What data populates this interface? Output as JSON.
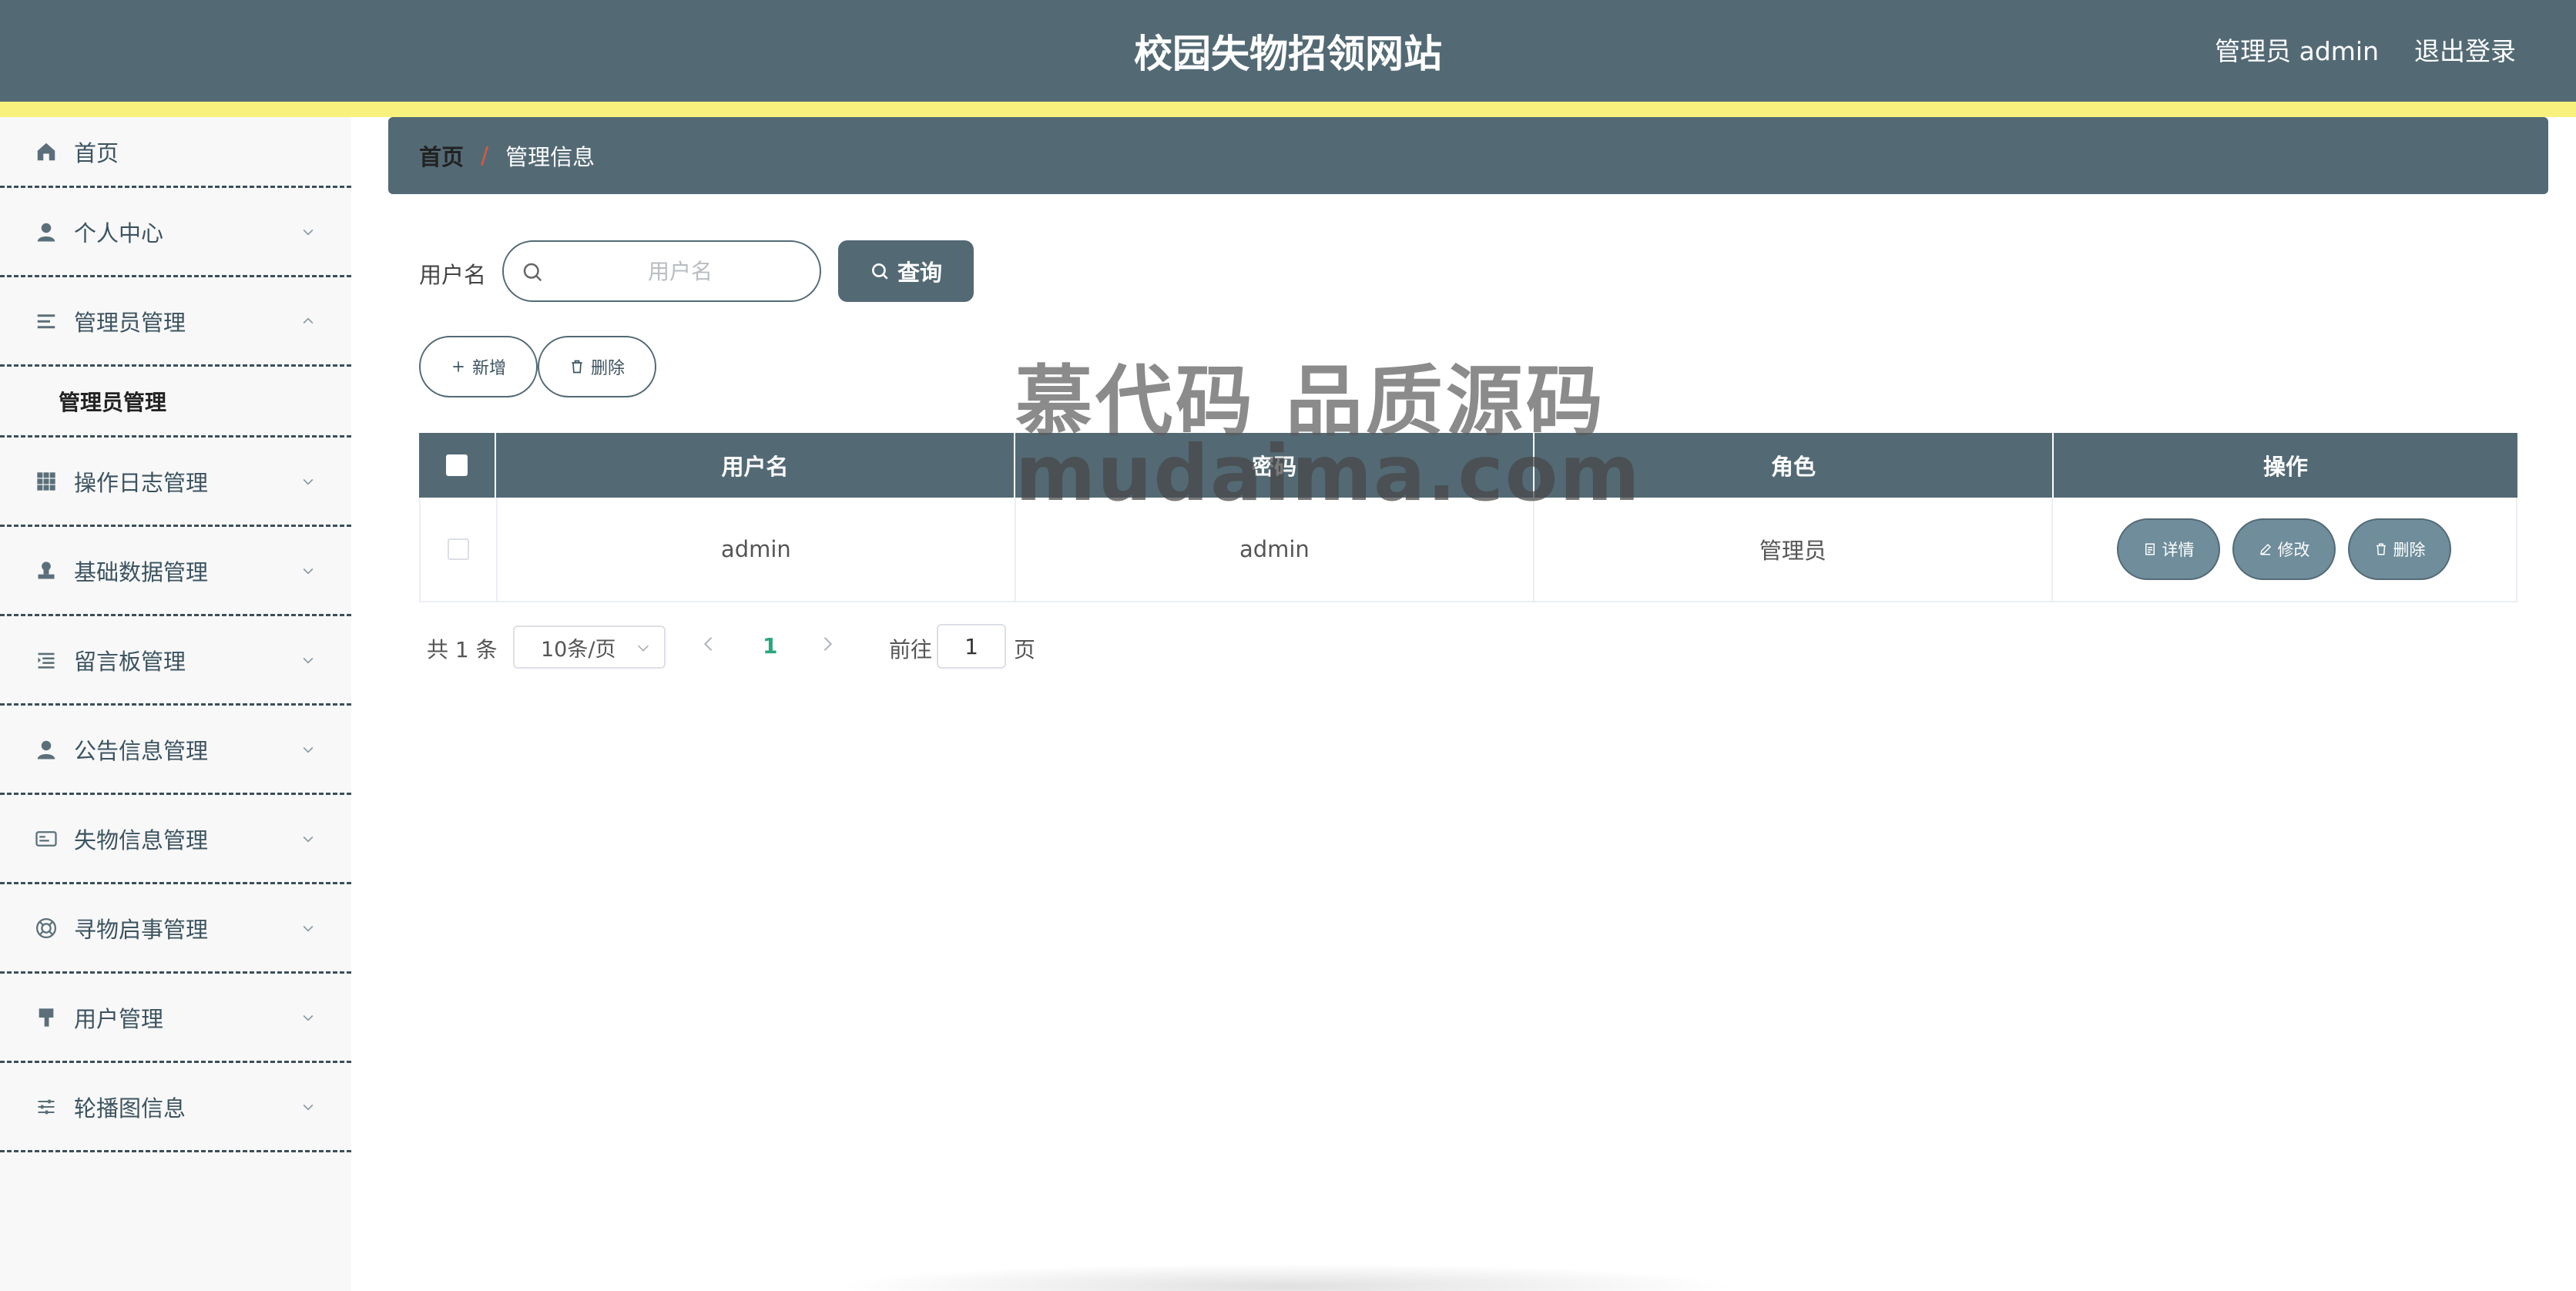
{
  "header": {
    "title": "校园失物招领网站",
    "user": "管理员 admin",
    "logout": "退出登录"
  },
  "colors": {
    "primary": "#536a75",
    "stripe": "#f9f17e",
    "button_fill": "#6f8d9b",
    "page_active": "#28a97b",
    "breadcrumb_sep": "#e0573d"
  },
  "sidebar": {
    "items": [
      {
        "label": "首页",
        "icon": "home-icon"
      },
      {
        "label": "个人中心",
        "icon": "user-icon"
      },
      {
        "label": "管理员管理",
        "icon": "list-icon",
        "expanded": true,
        "children": [
          {
            "label": "管理员管理"
          }
        ]
      },
      {
        "label": "操作日志管理",
        "icon": "grid-icon"
      },
      {
        "label": "基础数据管理",
        "icon": "stamp-icon"
      },
      {
        "label": "留言板管理",
        "icon": "menu-icon"
      },
      {
        "label": "公告信息管理",
        "icon": "user-icon"
      },
      {
        "label": "失物信息管理",
        "icon": "card-icon"
      },
      {
        "label": "寻物启事管理",
        "icon": "lifebuoy-icon"
      },
      {
        "label": "用户管理",
        "icon": "brush-icon"
      },
      {
        "label": "轮播图信息",
        "icon": "sliders-icon"
      }
    ]
  },
  "breadcrumb": {
    "home": "首页",
    "separator": "/",
    "current": "管理信息"
  },
  "search": {
    "label": "用户名",
    "placeholder": "用户名",
    "value": "",
    "query_button": "查询"
  },
  "actions": {
    "add": "新增",
    "delete": "删除"
  },
  "watermark": {
    "line1": "慕代码 品质源码",
    "line2": "mudaima.com"
  },
  "table": {
    "columns": [
      "用户名",
      "密码",
      "角色",
      "操作"
    ],
    "rows": [
      {
        "username": "admin",
        "password": "admin",
        "role": "管理员"
      }
    ],
    "row_actions": {
      "detail": "详情",
      "edit": "修改",
      "delete": "删除"
    }
  },
  "pagination": {
    "total": "共 1 条",
    "page_size": "10条/页",
    "current_page": "1",
    "goto_label": "前往",
    "goto_value": "1",
    "page_suffix": "页"
  }
}
